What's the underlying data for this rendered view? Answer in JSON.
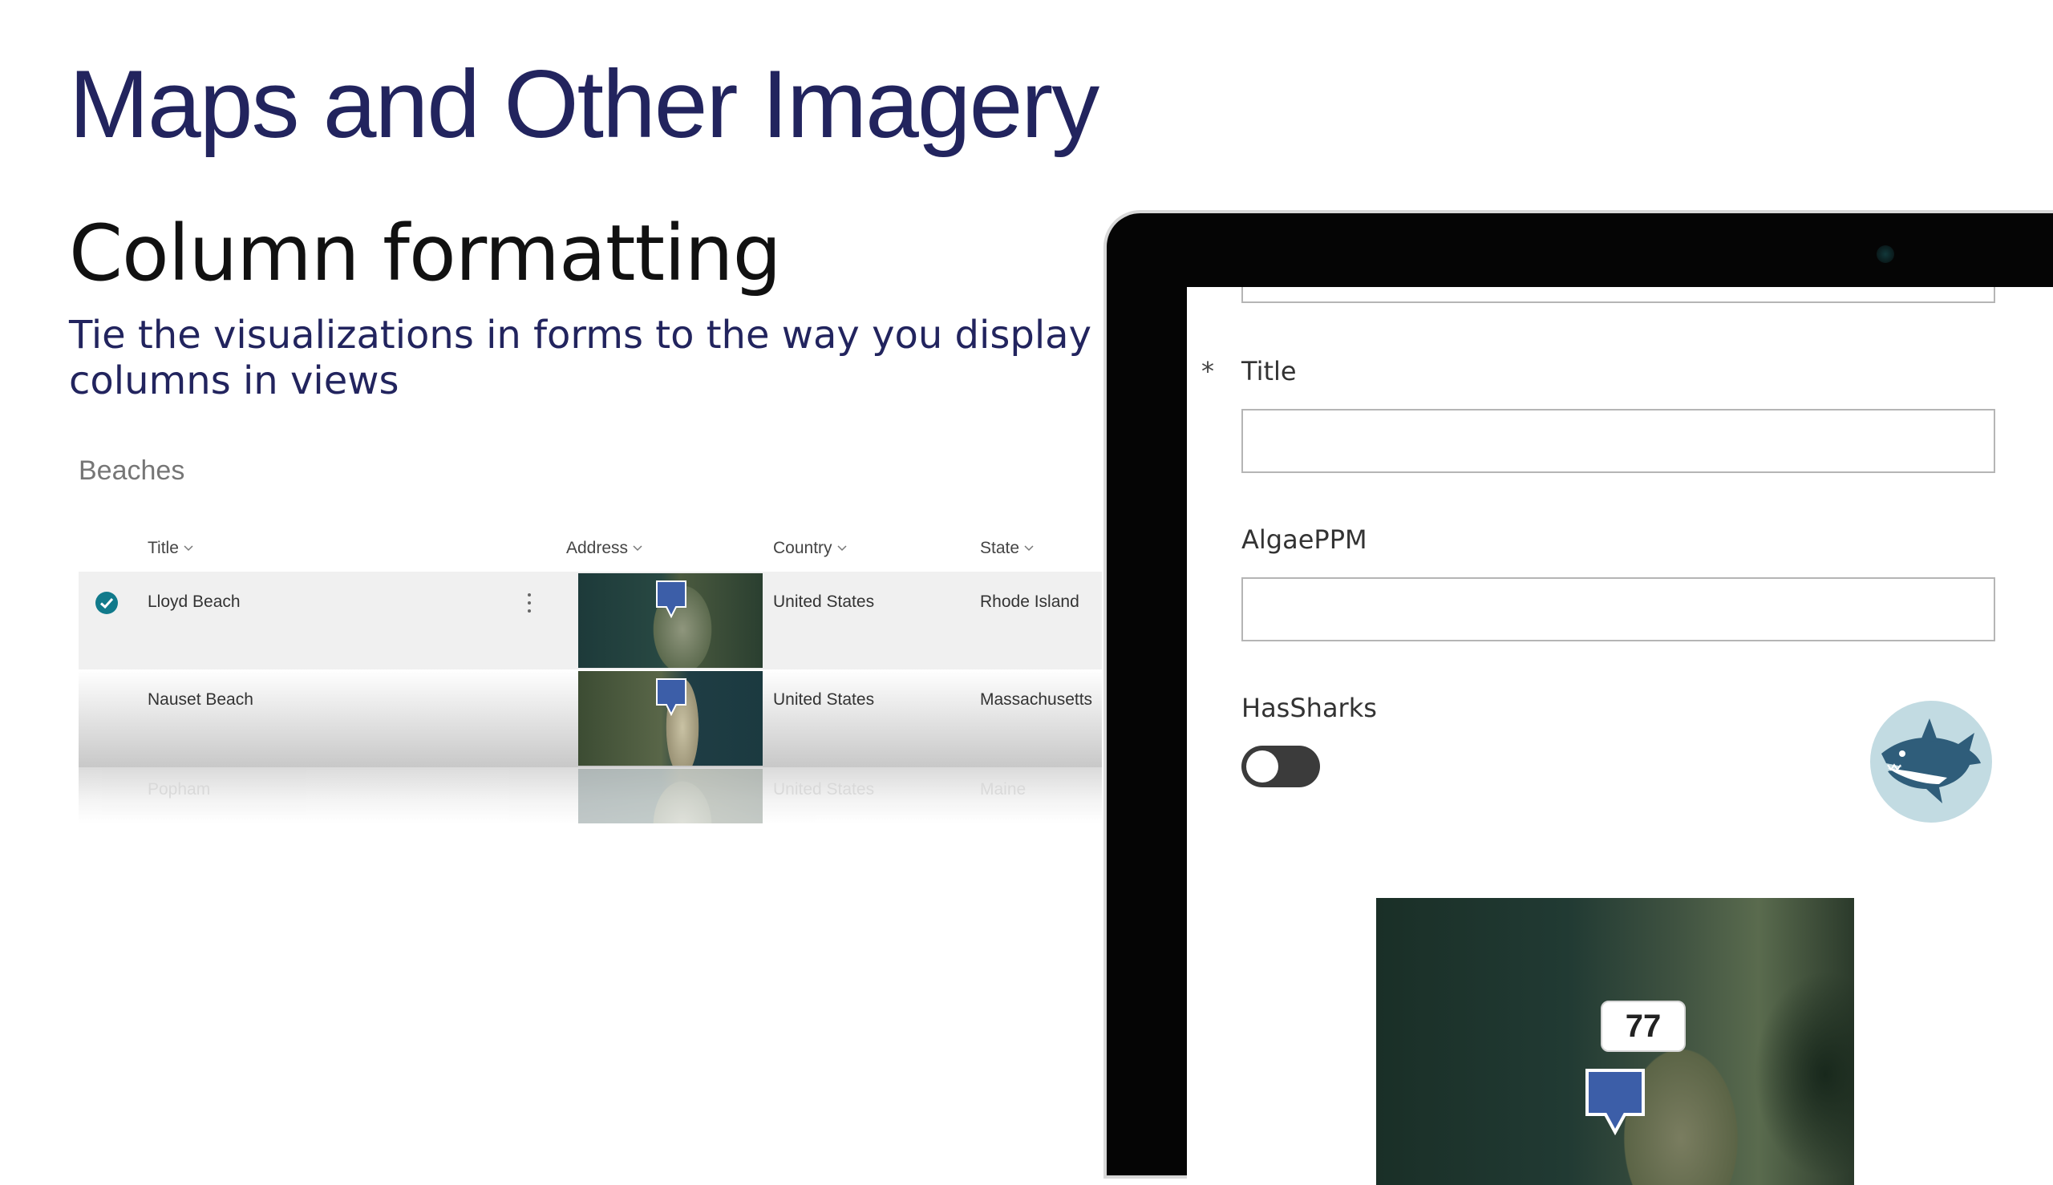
{
  "slide": {
    "title": "Maps and Other Imagery",
    "subtitle": "Column formatting",
    "tagline": "Tie the visualizations in forms to the way you display columns in views"
  },
  "list": {
    "name": "Beaches",
    "columns": [
      "Title",
      "Address",
      "Country",
      "State"
    ],
    "rows": [
      {
        "title": "Lloyd Beach",
        "country": "United States",
        "state": "Rhode Island"
      },
      {
        "title": "Nauset Beach",
        "country": "United States",
        "state": "Massachusetts"
      },
      {
        "title": "Popham",
        "country": "United States",
        "state": "Maine"
      }
    ]
  },
  "form": {
    "required_marker": "*",
    "fields": [
      {
        "label": "Title",
        "value": ""
      },
      {
        "label": "AlgaePPM",
        "value": ""
      },
      {
        "label": "HasSharks",
        "value": "off"
      }
    ],
    "map_badge": "77"
  },
  "colors": {
    "heading": "#22245e",
    "check": "#117a8b",
    "pin": "#3c5ea8",
    "shark_bg": "#c2dbe2"
  }
}
